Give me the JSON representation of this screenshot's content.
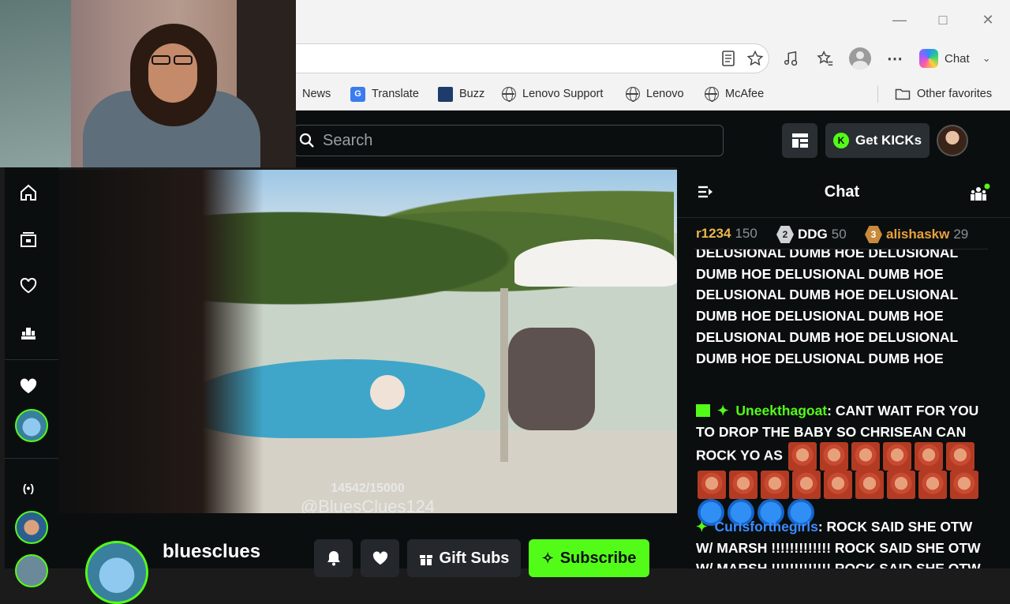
{
  "browser": {
    "toolbar": {
      "copilot_label": "Chat"
    },
    "favorites": [
      {
        "label": "News",
        "icon": "news-icon"
      },
      {
        "label": "Translate",
        "icon": "translate-icon"
      },
      {
        "label": "Buzz",
        "icon": "buzz-icon"
      },
      {
        "label": "Lenovo Support",
        "icon": "globe-icon"
      },
      {
        "label": "Lenovo",
        "icon": "globe-icon"
      },
      {
        "label": "McAfee",
        "icon": "globe-icon"
      }
    ],
    "other_favorites": "Other favorites"
  },
  "kick": {
    "search_placeholder": "Search",
    "get_kicks_label": "Get KICKs",
    "accent": "#53fc18"
  },
  "video": {
    "counter": "14542/15000",
    "watermark": "@BluesClues124"
  },
  "channel": {
    "name": "bluesclues",
    "gift_subs_label": "Gift Subs",
    "subscribe_label": "Subscribe"
  },
  "chat": {
    "title": "Chat",
    "leaderboard": [
      {
        "name": "r1234",
        "count": "150",
        "color": "#e9b84a",
        "badge": ""
      },
      {
        "name": "DDG",
        "count": "50",
        "color": "#ffffff",
        "badge": "2"
      },
      {
        "name": "alishaskw",
        "count": "29",
        "color": "#e9a23b",
        "badge": "3"
      }
    ],
    "messages": [
      {
        "user": "",
        "text": "DELUSIONAL DUMB HOE DELUSIONAL DUMB HOE DELUSIONAL DUMB HOE DELUSIONAL DUMB HOE DELUSIONAL DUMB HOE DELUSIONAL DUMB HOE DELUSIONAL DUMB HOE DELUSIONAL DUMB HOE DELUSIONAL DUMB HOE"
      },
      {
        "user": "Uneekthagoat",
        "user_color": "#53fc18",
        "text": "CANT WAIT FOR YOU TO DROP THE BABY SO CHRISEAN CAN ROCK YO AS"
      },
      {
        "user": "Curlsforthegirls",
        "user_color": "#3b8cff",
        "text": "ROCK SAID SHE OTW W/ MARSH !!!!!!!!!!!!! ROCK SAID SHE OTW W/ MARSH !!!!!!!!!!!!! ROCK SAID SHE OTW"
      }
    ]
  }
}
